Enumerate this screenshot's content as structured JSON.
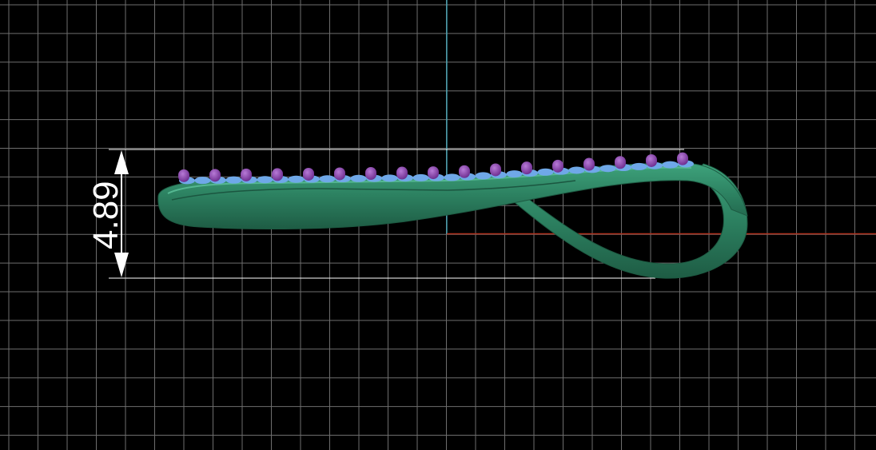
{
  "viewport": {
    "background": "#000000",
    "grid_color": "#6e6e6e",
    "axis_x_color": "#b0301c",
    "axis_y_color": "#43b5c8"
  },
  "dimension": {
    "label": "4.89",
    "color": "#ffffff"
  },
  "model": {
    "band_color": "#2f8a66",
    "band_edge_color": "#1f5e44",
    "prong_color": "#8a3fb0",
    "stone_color": "#6fa8e8"
  }
}
